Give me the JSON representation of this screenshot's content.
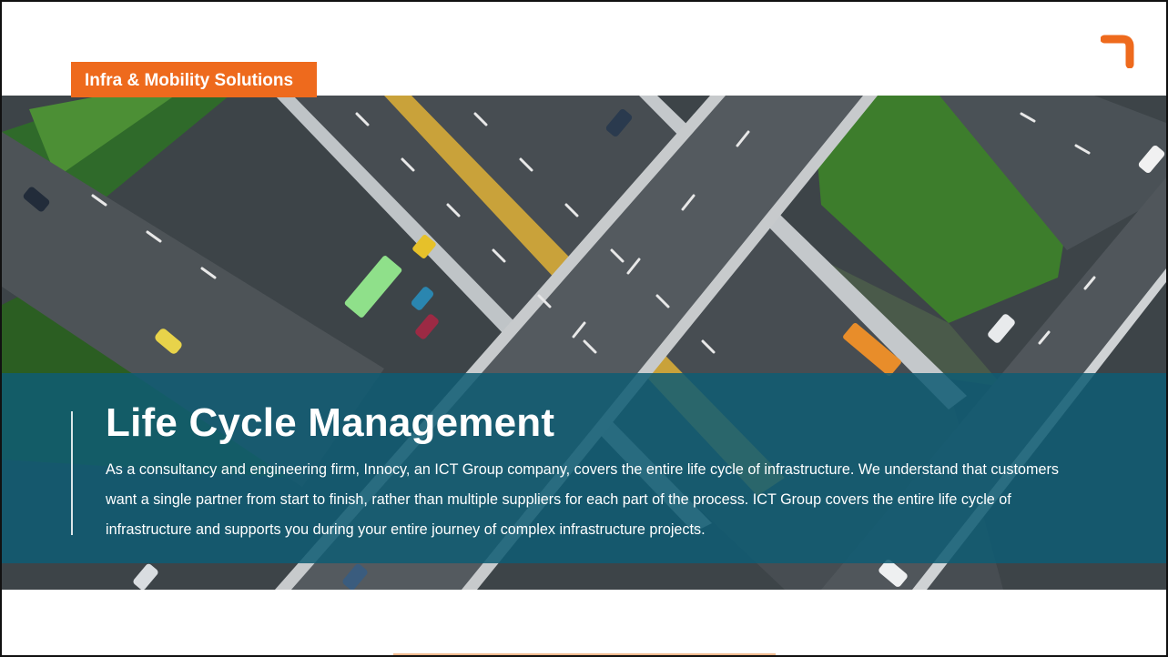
{
  "header": {
    "category_tag": "Infra & Mobility Solutions",
    "brand_color": "#ee6a1d"
  },
  "hero": {
    "image_subject": "aerial highway interchange",
    "overlay_color": "#0f5c73"
  },
  "content": {
    "title": "Life Cycle Management",
    "body": "As a consultancy and engineering firm, Innocy, an ICT Group company, covers the entire life cycle of infrastructure. We understand that customers want a single partner from start to finish, rather than multiple suppliers for each part of the process. ICT Group covers the entire life cycle of infrastructure and supports you during your entire journey of complex infrastructure projects."
  },
  "icons": {
    "logo": "corner-bracket-logo-icon"
  }
}
